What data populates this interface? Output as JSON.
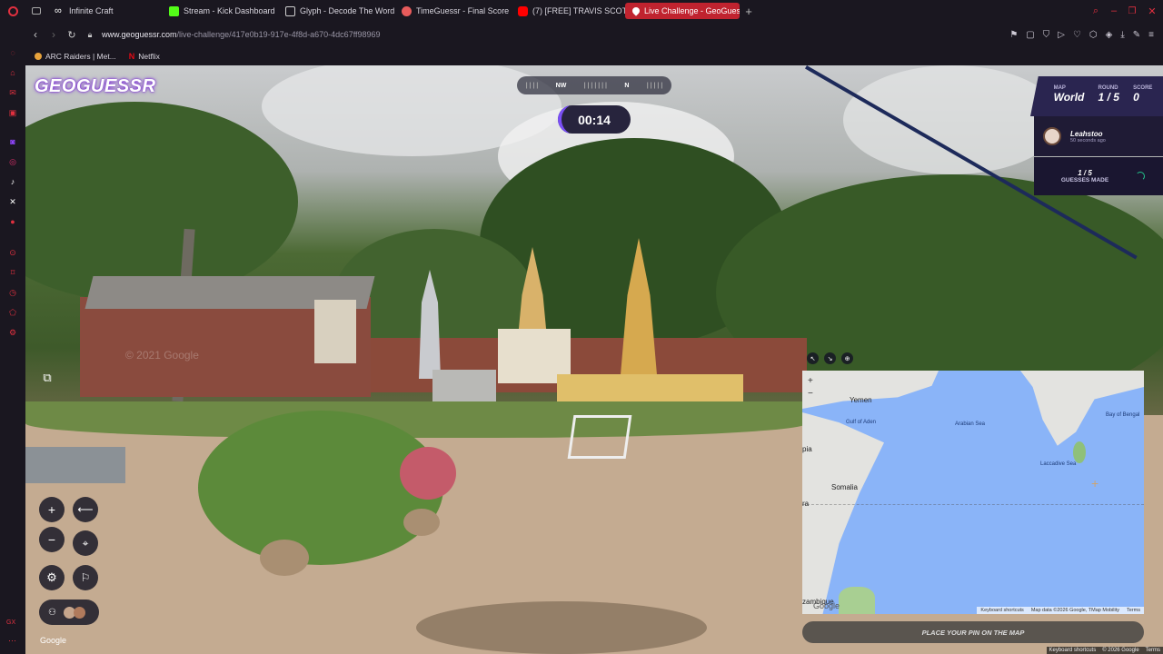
{
  "tabs": [
    {
      "label": "Infinite Craft",
      "favicon_color": "#ffffff",
      "active": false
    },
    {
      "label": "Stream - Kick Dashboard",
      "favicon_color": "#53fc18",
      "active": false
    },
    {
      "label": "Glyph - Decode The Word",
      "favicon_color": "#cfcfcf",
      "active": false
    },
    {
      "label": "TimeGuessr - Final Score",
      "favicon_color": "#e85b5b",
      "active": false
    },
    {
      "label": "(7) [FREE] TRAVIS SCOTT",
      "favicon_color": "#ff0000",
      "active": false
    },
    {
      "label": "Live Challenge - GeoGues",
      "favicon_color": "#ffffff",
      "active": true
    }
  ],
  "address": {
    "host": "www.geoguessr.com",
    "path": "/live-challenge/417e0b19-917e-4f8d-a670-4dc67ff98969"
  },
  "bookmarks": [
    {
      "label": "ARC Raiders | Met..."
    },
    {
      "label": "Netflix"
    }
  ],
  "game": {
    "logo": "GEOGUESSR",
    "timer": "00:14",
    "compass": {
      "left": "NW",
      "center": "N"
    },
    "stats": {
      "map_label": "MAP",
      "map_value": "World",
      "round_label": "ROUND",
      "round_value": "1 / 5",
      "score_label": "SCORE",
      "score_value": "0"
    },
    "player": {
      "name": "Leahstoo",
      "time_ago": "50 seconds ago"
    },
    "guesses": {
      "count": "1 / 5",
      "label": "GUESSES MADE"
    },
    "watermark": "© 2021 Google",
    "google_bottom": "Google",
    "place_pin_label": "PLACE YOUR PIN ON THE MAP"
  },
  "map": {
    "labels": {
      "yemen": "Yemen",
      "gulf": "Gulf of Aden",
      "arabian": "Arabian Sea",
      "bengal": "Bay of Bengal",
      "somalia": "Somalia",
      "laccadive": "Laccadive Sea",
      "pia": "pia",
      "ra": "ra",
      "zambique": "zambique"
    },
    "footer": {
      "shortcuts": "Keyboard shortcuts",
      "data": "Map data ©2026 Google, TMap Mobility",
      "terms": "Terms",
      "google": "Google"
    }
  },
  "page_footer": {
    "shortcuts": "Keyboard shortcuts",
    "data": "© 2026 Google",
    "terms": "Terms"
  },
  "sidebar_badge": "GX",
  "colors": {
    "accent": "#c0232f",
    "geo_purple": "#2a2550",
    "map_water": "#8ab4f8",
    "map_land": "#dadce0"
  }
}
